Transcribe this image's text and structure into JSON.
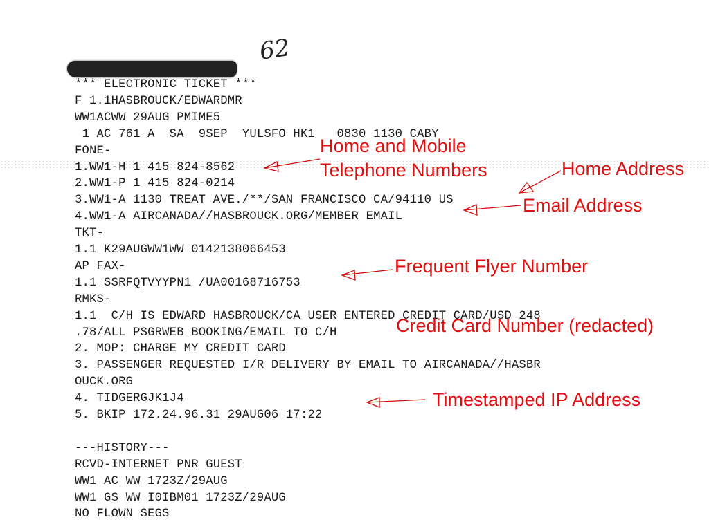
{
  "document": {
    "handwritten_note": "62",
    "lines": [
      "*** ELECTRONIC TICKET ***",
      "F 1.1HASBROUCK/EDWARDMR",
      "WW1ACWW 29AUG PMIME5",
      " 1 AC 761 A  SA  9SEP  YULSFO HK1   0830 1130 CABY",
      "FONE-",
      "1.WW1-H 1 415 824-8562",
      "2.WW1-P 1 415 824-0214",
      "3.WW1-A 1130 TREAT AVE./**/SAN FRANCISCO CA/94110 US",
      "4.WW1-A AIRCANADA//HASBROUCK.ORG/MEMBER EMAIL",
      "TKT-",
      "1.1 K29AUGWW1WW 0142138066453",
      "AP FAX-",
      "1.1 SSRFQTVYYPN1 /UA00168716753",
      "RMKS-",
      "1.1  C/H IS EDWARD HASBROUCK/CA USER ENTERED CREDIT CARD/USD 248",
      ".78/ALL PSGRWEB BOOKING/EMAIL TO C/H",
      "2. MOP: CHARGE MY CREDIT CARD",
      "3. PASSENGER REQUESTED I/R DELIVERY BY EMAIL TO AIRCANADA//HASBR",
      "OUCK.ORG",
      "4. TIDGERGJK1J4",
      "5. BKIP 172.24.96.31 29AUG06 17:22",
      "",
      "---HISTORY---",
      "RCVD-INTERNET PNR GUEST",
      "WW1 AC WW 1723Z/29AUG",
      "WW1 GS WW I0IBM01 1723Z/29AUG",
      "NO FLOWN SEGS"
    ]
  },
  "annotations": {
    "phones_line1": "Home and Mobile",
    "phones_line2": "Telephone Numbers",
    "home_address": "Home Address",
    "email_address": "Email Address",
    "frequent_flyer": "Frequent Flyer Number",
    "credit_card": "Credit Card Number (redacted)",
    "ip_address": "Timestamped IP Address",
    "color": "#dd1111"
  }
}
